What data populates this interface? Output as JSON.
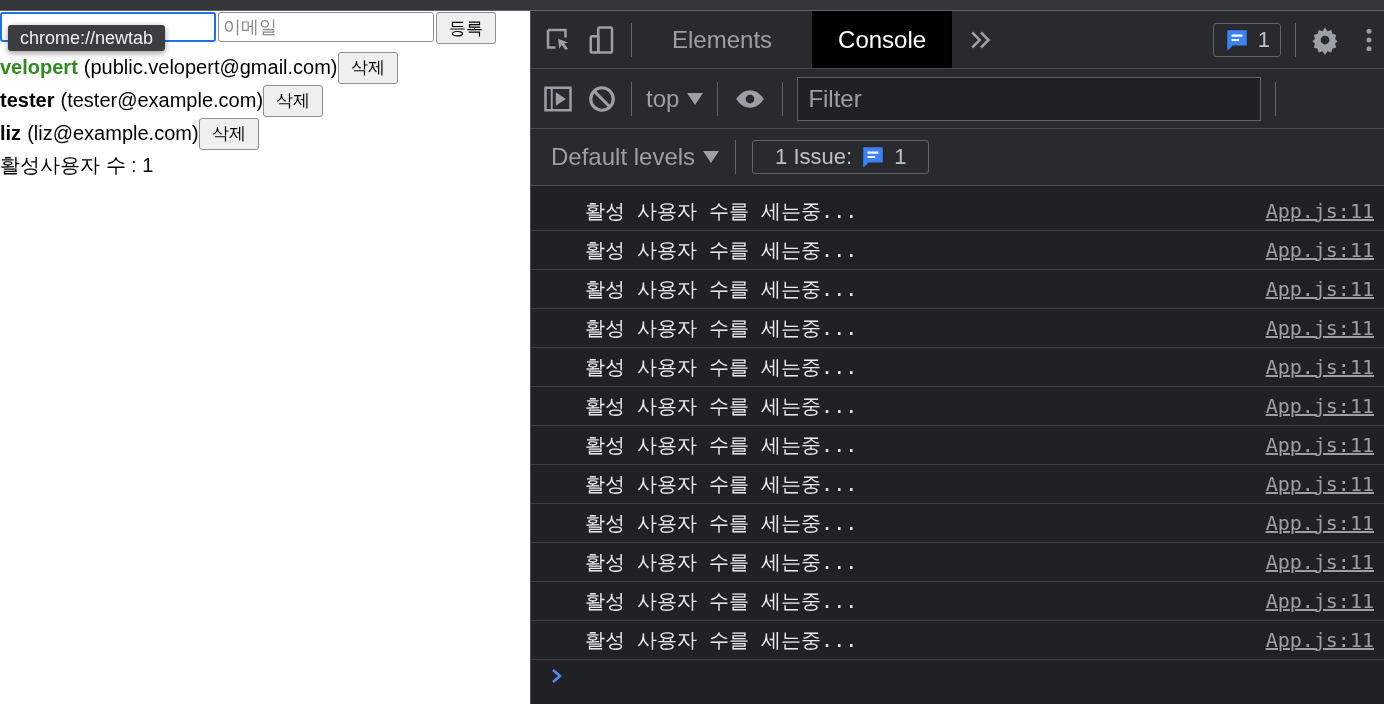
{
  "app": {
    "form": {
      "username": {
        "focused": true
      },
      "email": {
        "placeholder": "이메일"
      },
      "submit": "등록"
    },
    "tooltip": "chrome://newtab",
    "users": [
      {
        "username": "velopert",
        "email": "(public.velopert@gmail.com)",
        "active": true,
        "remove": "삭제"
      },
      {
        "username": "tester",
        "email": "(tester@example.com)",
        "active": false,
        "remove": "삭제"
      },
      {
        "username": "liz",
        "email": "(liz@example.com)",
        "active": false,
        "remove": "삭제"
      }
    ],
    "active_count": "활성사용자 수 : 1"
  },
  "devtools": {
    "tabs": [
      {
        "label": "Elements",
        "selected": false
      },
      {
        "label": "Console",
        "selected": true
      }
    ],
    "issues_badge": "1",
    "context": "top",
    "filter": {
      "placeholder": "Filter"
    },
    "levels": "Default levels",
    "issues": {
      "label": "1 Issue:",
      "count": "1"
    },
    "messages": [
      {
        "text": "활성 사용자 수를 세는중...",
        "source": "App.js:11"
      },
      {
        "text": "활성 사용자 수를 세는중...",
        "source": "App.js:11"
      },
      {
        "text": "활성 사용자 수를 세는중...",
        "source": "App.js:11"
      },
      {
        "text": "활성 사용자 수를 세는중...",
        "source": "App.js:11"
      },
      {
        "text": "활성 사용자 수를 세는중...",
        "source": "App.js:11"
      },
      {
        "text": "활성 사용자 수를 세는중...",
        "source": "App.js:11"
      },
      {
        "text": "활성 사용자 수를 세는중...",
        "source": "App.js:11"
      },
      {
        "text": "활성 사용자 수를 세는중...",
        "source": "App.js:11"
      },
      {
        "text": "활성 사용자 수를 세는중...",
        "source": "App.js:11"
      },
      {
        "text": "활성 사용자 수를 세는중...",
        "source": "App.js:11"
      },
      {
        "text": "활성 사용자 수를 세는중...",
        "source": "App.js:11"
      },
      {
        "text": "활성 사용자 수를 세는중...",
        "source": "App.js:11"
      }
    ]
  }
}
